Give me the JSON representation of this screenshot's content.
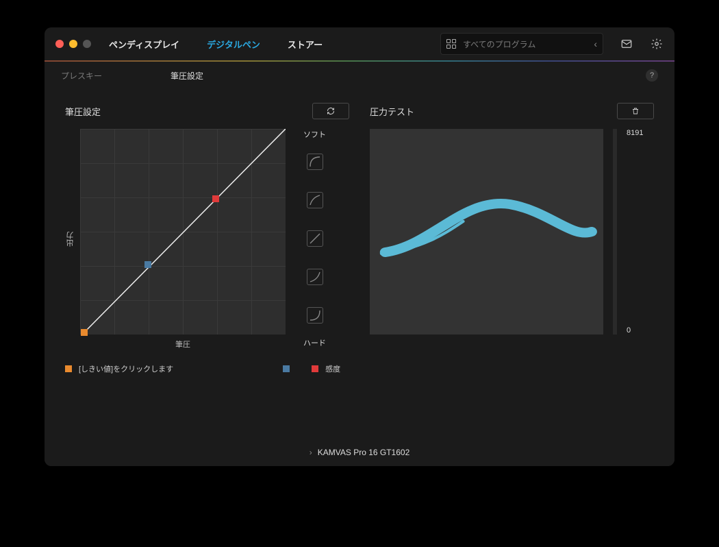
{
  "header": {
    "tabs": [
      {
        "id": "display",
        "label": "ペンディスプレイ",
        "active": false
      },
      {
        "id": "pen",
        "label": "デジタルペン",
        "active": true
      },
      {
        "id": "store",
        "label": "ストアー",
        "active": false
      }
    ],
    "app_selector": {
      "label": "すべてのプログラム"
    }
  },
  "sub_tabs": [
    {
      "id": "presskey",
      "label": "プレスキー",
      "active": false
    },
    {
      "id": "pressure",
      "label": "筆圧設定",
      "active": true
    }
  ],
  "help_label": "?",
  "pressure_panel": {
    "title": "筆圧設定",
    "y_axis_label": "出力",
    "x_axis_label": "筆圧",
    "soft_label": "ソフト",
    "hard_label": "ハード",
    "legend_threshold": "[しきい値]をクリックします",
    "legend_sensitivity": "感度"
  },
  "test_panel": {
    "title": "圧力テスト",
    "max_value": "8191",
    "min_value": "0"
  },
  "colors": {
    "threshold": "#e98a2e",
    "mid": "#4a7aa2",
    "sensitivity": "#e03a3a",
    "stroke": "#5bbad6"
  },
  "chart_data": {
    "type": "line",
    "title": "筆圧設定",
    "xlabel": "筆圧",
    "ylabel": "出力",
    "xlim": [
      0,
      100
    ],
    "ylim": [
      0,
      100
    ],
    "series": [
      {
        "name": "curve",
        "x": [
          0,
          100
        ],
        "y": [
          0,
          100
        ]
      }
    ],
    "points": [
      {
        "name": "threshold",
        "x": 2,
        "y": 1,
        "color": "#e98a2e"
      },
      {
        "name": "mid",
        "x": 33,
        "y": 34,
        "color": "#4a7aa2"
      },
      {
        "name": "sensitivity",
        "x": 66,
        "y": 66,
        "color": "#e03a3a"
      }
    ]
  },
  "device": {
    "name": "KAMVAS Pro 16 GT1602"
  }
}
